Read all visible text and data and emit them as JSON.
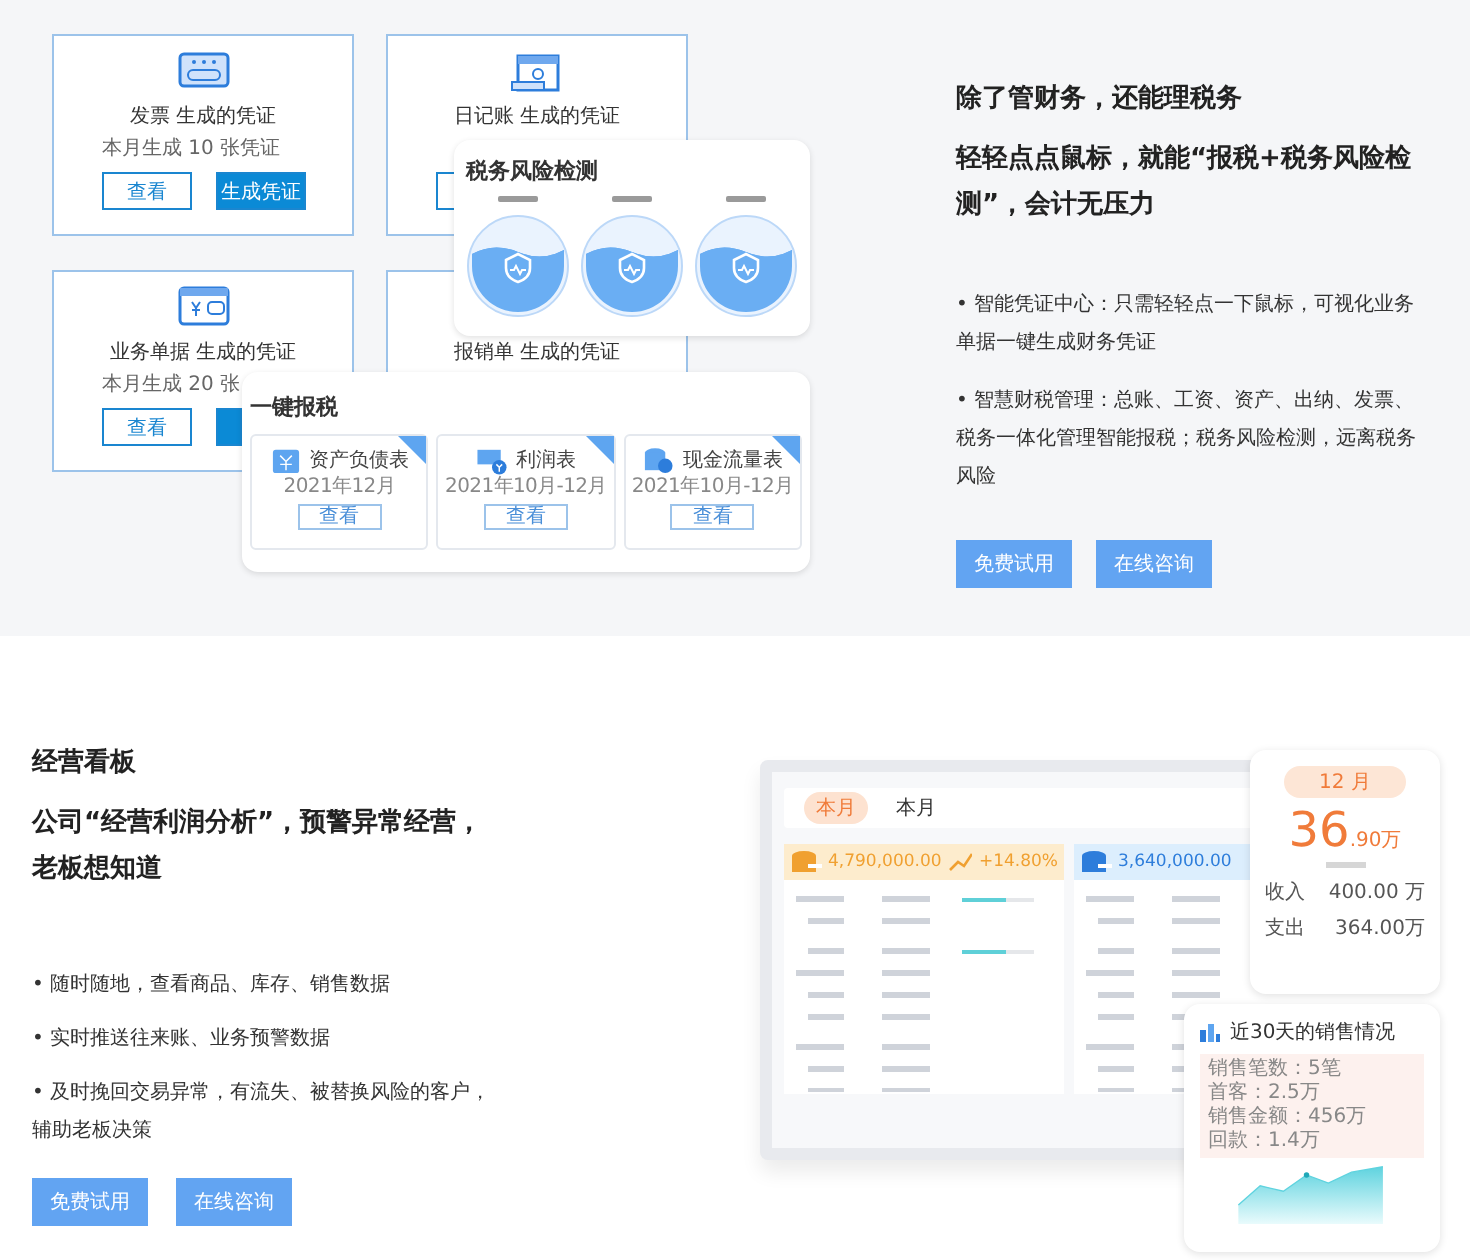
{
  "tax_section": {
    "voucher_cards": [
      {
        "title": "发票 生成的凭证",
        "count_text": "本月生成 10 张凭证",
        "buttons": [
          "查看",
          "生成凭证"
        ]
      },
      {
        "title": "日记账 生成的凭证"
      },
      {
        "title": "业务单据 生成的凭证",
        "count_text": "本月生成 20 张",
        "buttons": [
          "查看"
        ]
      },
      {
        "title": "报销单 生成的凭证"
      }
    ],
    "risk_panel": {
      "title": "税务风险检测"
    },
    "filing_panel": {
      "title": "一键报税",
      "reports": [
        {
          "name": "资产负债表",
          "period": "2021年12月",
          "button": "查看"
        },
        {
          "name": "利润表",
          "period": "2021年10月-12月",
          "button": "查看"
        },
        {
          "name": "现金流量表",
          "period": "2021年10月-12月",
          "button": "查看"
        }
      ]
    },
    "heading": [
      "除了管财务，还能理税务",
      "轻轻点点鼠标，就能“报税+税务风险检测”，会计无压力"
    ],
    "bullets": [
      "• 智能凭证中心：只需轻轻点一下鼠标，可视化业务单据一键生成财务凭证",
      "• 智慧财税管理：总账、工资、资产、出纳、发票、税务一体化管理智能报税；税务风险检测，远离税务风险"
    ],
    "buttons": [
      "免费试用",
      "在线咨询"
    ]
  },
  "board_section": {
    "label": "经营看板",
    "heading": "公司“经营利润分析”，预警异常经营，老板想知道",
    "bullets": [
      "• 随时随地，查看商品、库存、销售数据",
      "• 实时推送往来账、业务预警数据",
      "• 及时挽回交易异常，有流失、被替换风险的客户，辅助老板决策"
    ],
    "buttons": [
      "免费试用",
      "在线咨询"
    ],
    "dashboard": {
      "tabs": [
        {
          "label": "本月",
          "selected": true
        },
        {
          "label": "本月",
          "selected": false
        }
      ],
      "tiles": [
        {
          "amount": "4,790,000.00",
          "change": "+14.80%"
        },
        {
          "amount": "3,640,000.00"
        }
      ],
      "month_card": {
        "month": "12 月",
        "value": "36",
        "unit": ".90万",
        "rows": [
          {
            "label": "收入",
            "value": "400.00 万"
          },
          {
            "label": "支出",
            "value": "364.00万"
          }
        ]
      },
      "sales_card": {
        "title": "近30天的销售情况",
        "stats": [
          "销售笔数：5笔",
          "首客：2.5万",
          "销售金额：456万",
          "回款：1.4万"
        ]
      }
    }
  }
}
